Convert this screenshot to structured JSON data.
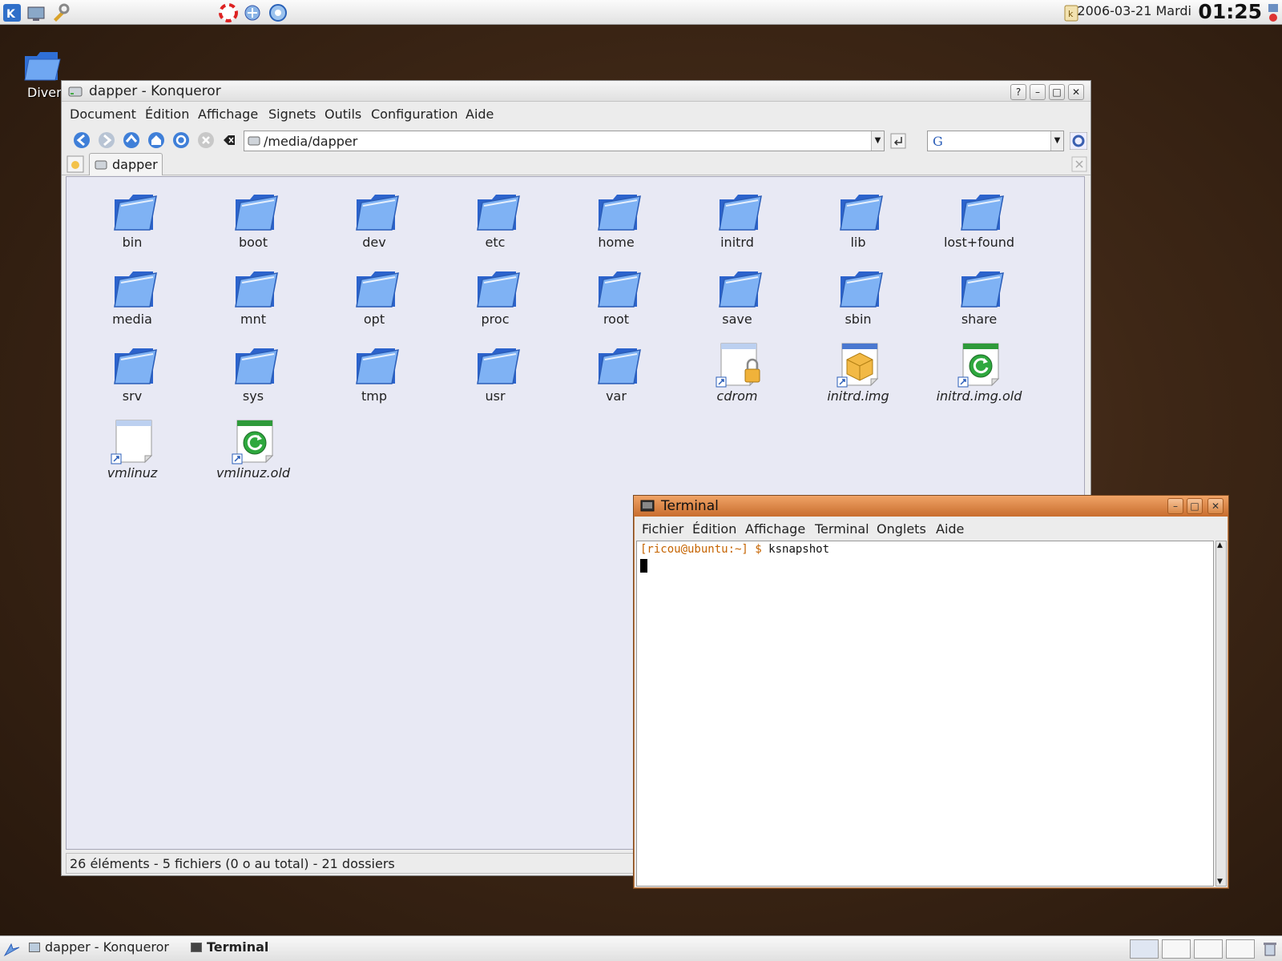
{
  "top_panel": {
    "launcher_icons": [
      "kde-menu-icon",
      "show-desktop-icon",
      "control-center-icon",
      "help-icon",
      "network-icon",
      "browser-icon"
    ],
    "date": "2006-03-21 Mardi",
    "time": "01:25"
  },
  "desktop": {
    "icon_label": "Divers"
  },
  "konqueror": {
    "title": "dapper - Konqueror",
    "menus": [
      "Document",
      "Édition",
      "Affichage",
      "Signets",
      "Outils",
      "Configuration",
      "Aide"
    ],
    "url": "/media/dapper",
    "search_value": "",
    "tab_label": "dapper",
    "files": [
      {
        "name": "bin",
        "kind": "folder"
      },
      {
        "name": "boot",
        "kind": "folder"
      },
      {
        "name": "dev",
        "kind": "folder"
      },
      {
        "name": "etc",
        "kind": "folder"
      },
      {
        "name": "home",
        "kind": "folder"
      },
      {
        "name": "initrd",
        "kind": "folder"
      },
      {
        "name": "lib",
        "kind": "folder"
      },
      {
        "name": "lost+found",
        "kind": "folder"
      },
      {
        "name": "media",
        "kind": "folder"
      },
      {
        "name": "mnt",
        "kind": "folder"
      },
      {
        "name": "opt",
        "kind": "folder"
      },
      {
        "name": "proc",
        "kind": "folder"
      },
      {
        "name": "root",
        "kind": "folder"
      },
      {
        "name": "save",
        "kind": "folder"
      },
      {
        "name": "sbin",
        "kind": "folder"
      },
      {
        "name": "share",
        "kind": "folder"
      },
      {
        "name": "srv",
        "kind": "folder"
      },
      {
        "name": "sys",
        "kind": "folder"
      },
      {
        "name": "tmp",
        "kind": "folder"
      },
      {
        "name": "usr",
        "kind": "folder"
      },
      {
        "name": "var",
        "kind": "folder"
      },
      {
        "name": "cdrom",
        "kind": "locked-link"
      },
      {
        "name": "initrd.img",
        "kind": "package-link"
      },
      {
        "name": "initrd.img.old",
        "kind": "recycled-link"
      },
      {
        "name": "vmlinuz",
        "kind": "file-link"
      },
      {
        "name": "vmlinuz.old",
        "kind": "recycled-link"
      }
    ],
    "status": "26 éléments - 5 fichiers (0 o au total) - 21 dossiers"
  },
  "terminal": {
    "title": "Terminal",
    "menus": [
      "Fichier",
      "Édition",
      "Affichage",
      "Terminal",
      "Onglets",
      "Aide"
    ],
    "prompt": "[ricou@ubuntu:~] $ ",
    "command": "ksnapshot"
  },
  "taskbar": {
    "tasks": [
      "dapper - Konqueror",
      "Terminal"
    ]
  },
  "colors": {
    "accent_terminal": "#d47a38",
    "folder_blue": "#3a7be0",
    "view_background": "#e8e9f4"
  }
}
